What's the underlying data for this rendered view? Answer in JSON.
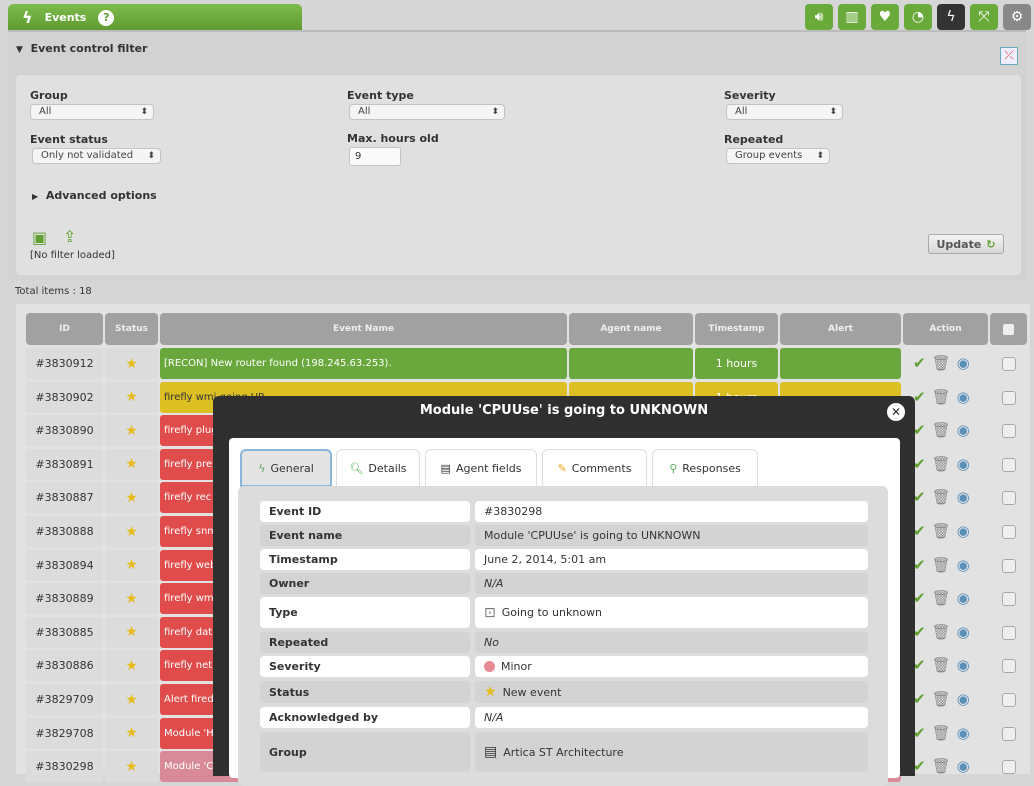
{
  "header": {
    "tab_label": "Events",
    "help_icon": "?",
    "toolbar": [
      "sound-icon",
      "chart-icon",
      "heart-icon",
      "rss-icon",
      "events-icon",
      "fullscreen-icon",
      "gear-icon"
    ]
  },
  "filter": {
    "title": "Event control filter",
    "group_label": "Group",
    "group_value": "All",
    "event_type_label": "Event type",
    "event_type_value": "All",
    "severity_label": "Severity",
    "severity_value": "All",
    "event_status_label": "Event status",
    "event_status_value": "Only not validated",
    "max_hours_label": "Max. hours old",
    "max_hours_value": "9",
    "repeated_label": "Repeated",
    "repeated_value": "Group events",
    "advanced": "Advanced options",
    "no_filter": "[No filter loaded]",
    "update": "Update"
  },
  "total_items": "Total items : 18",
  "table": {
    "headers": [
      "ID",
      "Status",
      "Event Name",
      "Agent name",
      "Timestamp",
      "Alert",
      "Action"
    ],
    "rows": [
      {
        "id": "#3830912",
        "name": "[RECON] New router found (198.245.63.253).",
        "ts": "1 hours",
        "color": "#6aa83e"
      },
      {
        "id": "#3830902",
        "name": "firefly wmi going UP",
        "ts": "1 hours",
        "color": "#dcbf23"
      },
      {
        "id": "#3830890",
        "name": "firefly plug",
        "ts": "",
        "color": "#e04b4b"
      },
      {
        "id": "#3830891",
        "name": "firefly pre",
        "ts": "",
        "color": "#e04b4b"
      },
      {
        "id": "#3830887",
        "name": "firefly rec",
        "ts": "",
        "color": "#e04b4b"
      },
      {
        "id": "#3830888",
        "name": "firefly snm",
        "ts": "",
        "color": "#e04b4b"
      },
      {
        "id": "#3830894",
        "name": "firefly web",
        "ts": "",
        "color": "#e04b4b"
      },
      {
        "id": "#3830889",
        "name": "firefly wm",
        "ts": "",
        "color": "#e04b4b"
      },
      {
        "id": "#3830885",
        "name": "firefly dat",
        "ts": "",
        "color": "#e04b4b"
      },
      {
        "id": "#3830886",
        "name": "firefly net",
        "ts": "",
        "color": "#e04b4b"
      },
      {
        "id": "#3829709",
        "name": "Alert fired",
        "ts": "",
        "color": "#e04b4b"
      },
      {
        "id": "#3829708",
        "name": "Module 'H",
        "ts": "",
        "color": "#e04b4b"
      },
      {
        "id": "#3830298",
        "name": "Module 'C",
        "ts": "",
        "color": "#d98a98"
      }
    ]
  },
  "modal": {
    "title": "Module 'CPUUse' is going to UNKNOWN",
    "tabs": [
      "General",
      "Details",
      "Agent fields",
      "Comments",
      "Responses"
    ],
    "fields": [
      {
        "label": "Event ID",
        "value": "#3830298"
      },
      {
        "label": "Event name",
        "value": "Module 'CPUUse' is going to UNKNOWN"
      },
      {
        "label": "Timestamp",
        "value": "June 2, 2014, 5:01 am"
      },
      {
        "label": "Owner",
        "value": "N/A"
      },
      {
        "label": "Type",
        "value": "Going to unknown"
      },
      {
        "label": "Repeated",
        "value": "No"
      },
      {
        "label": "Severity",
        "value": "Minor"
      },
      {
        "label": "Status",
        "value": "New event"
      },
      {
        "label": "Acknowledged by",
        "value": "N/A"
      },
      {
        "label": "Group",
        "value": "Artica ST Architecture"
      }
    ]
  },
  "colors": {
    "green": "#6aa83e",
    "yellow": "#dcbf23",
    "red": "#e04b4b",
    "minor": "#e88a96"
  }
}
